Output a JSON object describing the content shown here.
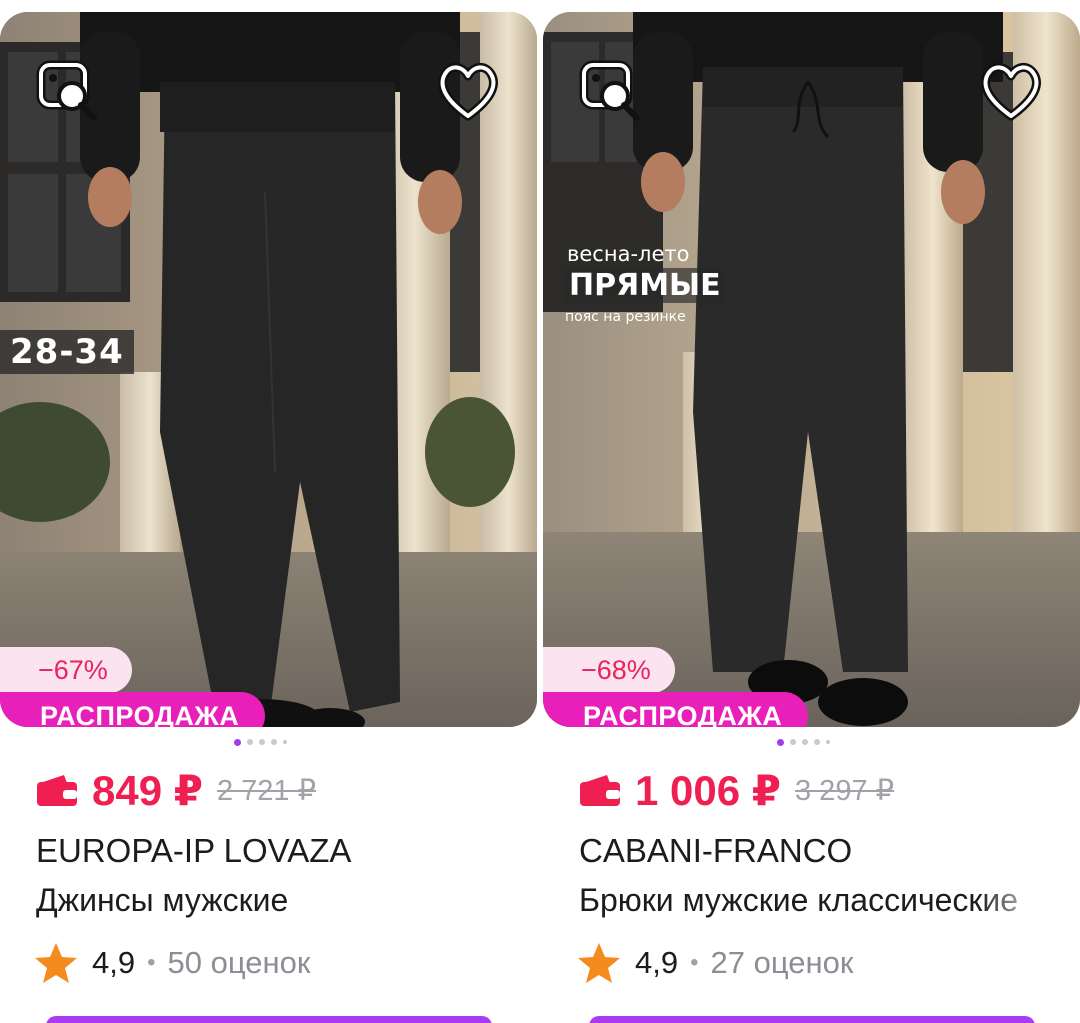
{
  "products": [
    {
      "discount": "−67%",
      "sale_label": "РАСПРОДАЖА",
      "size_badge": "28-34",
      "price": "849 ₽",
      "old_price": "2 721 ₽",
      "brand": "EUROPA-IP LOVAZA",
      "title": "Джинсы мужские",
      "rating": "4,9",
      "separator": "•",
      "reviews": "50 оценок"
    },
    {
      "discount": "−68%",
      "sale_label": "РАСПРОДАЖА",
      "overlay_line1": "весна-лето",
      "overlay_line2": "ПРЯМЫЕ",
      "overlay_line3": "пояс на резинке",
      "price": "1 006 ₽",
      "old_price": "3 297 ₽",
      "brand": "CABANI-FRANCO",
      "title": "Брюки мужские классические",
      "rating": "4,9",
      "separator": "•",
      "reviews": "27 оценок"
    }
  ],
  "icons": {
    "visual_search": "image-search-icon",
    "favorite": "heart-icon",
    "wallet": "wallet-icon",
    "rating": "star-icon"
  },
  "colors": {
    "price": "#ef1f52",
    "sale_badge": "#e820b9",
    "discount_bg": "#fbe3ef",
    "star": "#f58a1f",
    "accent": "#a93cf2"
  }
}
